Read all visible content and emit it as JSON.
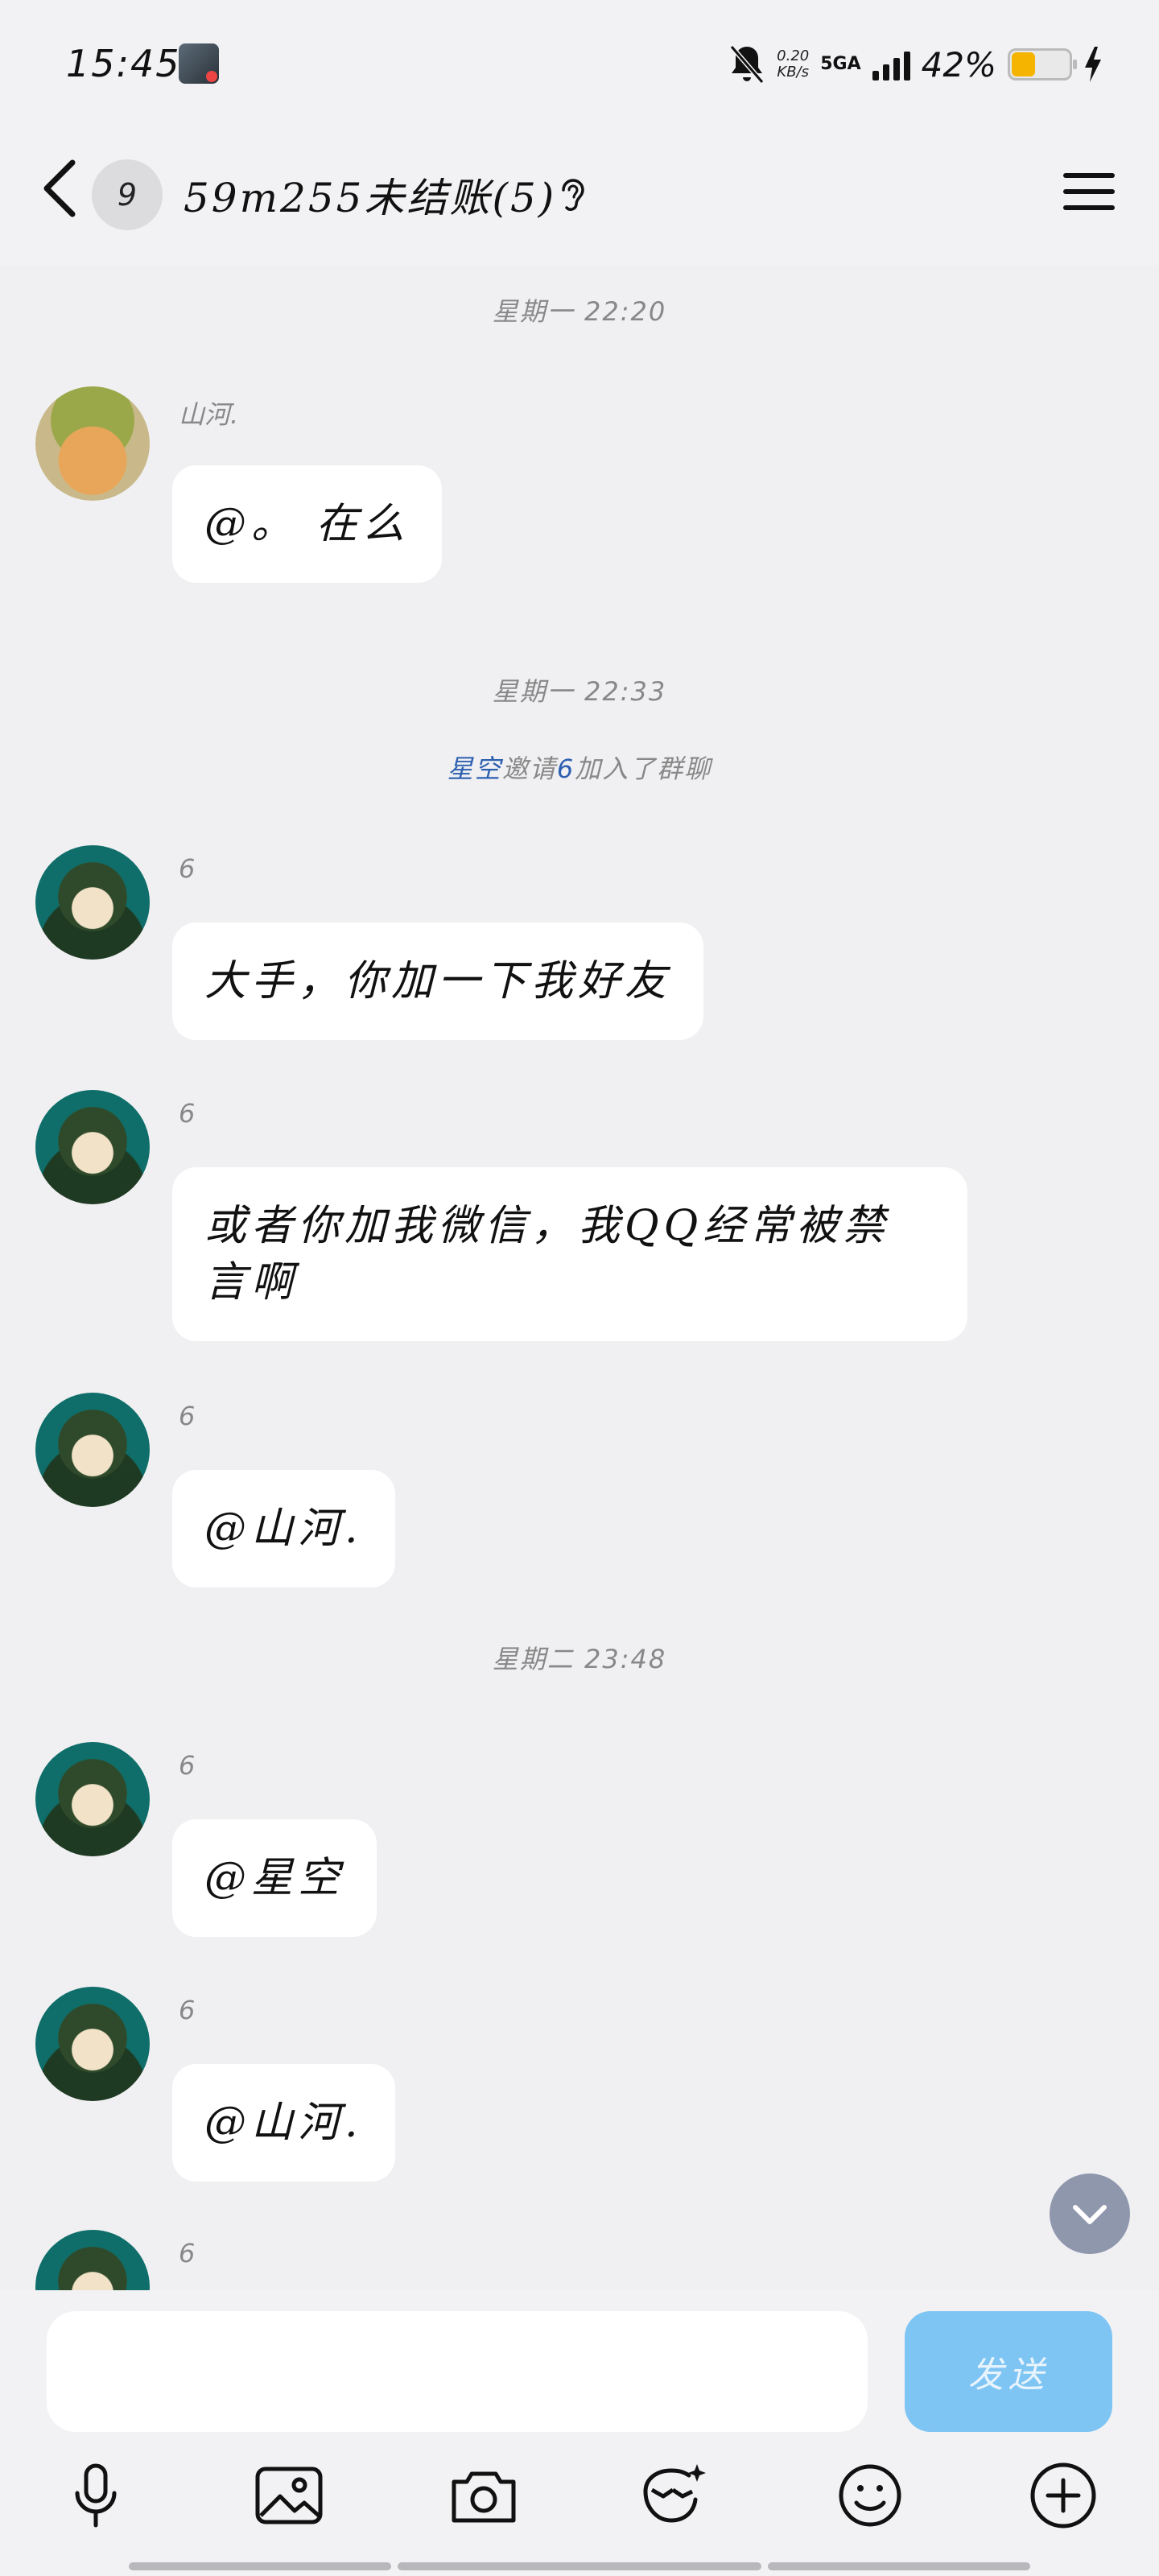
{
  "status_bar": {
    "time": "15:45",
    "net_speed_value": "0.20",
    "net_speed_unit": "KB/s",
    "network": "5GA",
    "battery_pct": "42%",
    "battery_level": 0.42
  },
  "header": {
    "unread_count": "9",
    "title": "59m255未结账(5)"
  },
  "chat": {
    "timestamps": [
      "星期一 22:20",
      "星期一 22:33",
      "星期二 23:48"
    ],
    "system_notice": {
      "inviter": "星空",
      "mid": "邀请",
      "invitee": "6",
      "tail": "加入了群聊"
    },
    "messages": [
      {
        "sender": "山河.",
        "text": "@。 在么"
      },
      {
        "sender": "6",
        "text": "大手，你加一下我好友"
      },
      {
        "sender": "6",
        "text_line1": "或者你加我微信，我QQ经常被禁",
        "text_line2": "言啊"
      },
      {
        "sender": "6",
        "text": "@山河."
      },
      {
        "sender": "6",
        "text": "@星空"
      },
      {
        "sender": "6",
        "text": "@山河."
      },
      {
        "sender": "6"
      }
    ]
  },
  "input": {
    "send_label": "发送"
  },
  "toolbar": {
    "icons": [
      "microphone-icon",
      "image-icon",
      "camera-icon",
      "sticker-icon",
      "emoji-icon",
      "plus-icon"
    ]
  },
  "colors": {
    "accent_link": "#2d5fb0",
    "send_button": "#7fc5f4",
    "battery_fill": "#f5b400",
    "background": "#f0f0f3"
  }
}
